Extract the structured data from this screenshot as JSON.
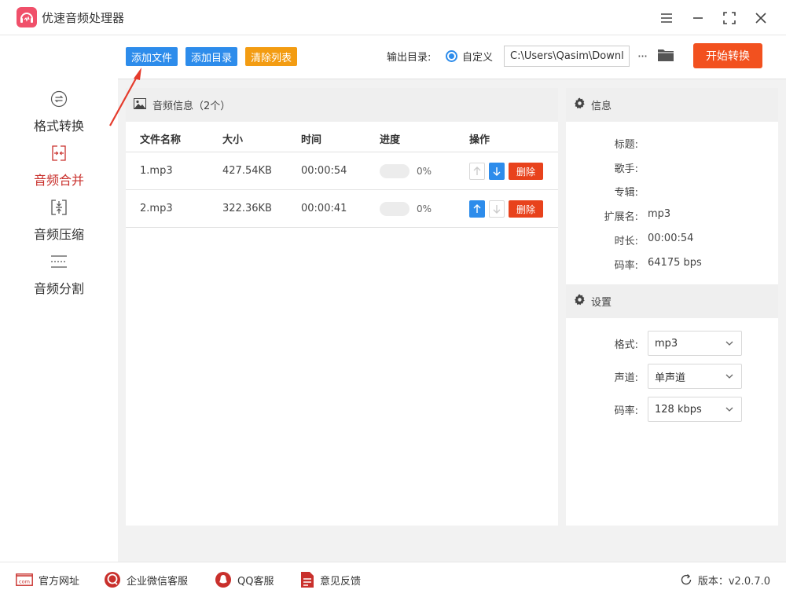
{
  "app": {
    "title": "优速音频处理器"
  },
  "sidebar": {
    "items": [
      {
        "label": "格式转换",
        "icon": "format-convert-icon",
        "active": false
      },
      {
        "label": "音频合并",
        "icon": "audio-merge-icon",
        "active": true
      },
      {
        "label": "音频压缩",
        "icon": "audio-compress-icon",
        "active": false
      },
      {
        "label": "音频分割",
        "icon": "audio-split-icon",
        "active": false
      }
    ]
  },
  "toolbar": {
    "add_file": "添加文件",
    "add_dir": "添加目录",
    "clear_list": "清除列表",
    "output_label": "输出目录:",
    "output_option": "自定义",
    "output_path": "C:\\Users\\Qasim\\Downloads",
    "more": "···",
    "start": "开始转换"
  },
  "audio_panel": {
    "title": "音频信息（2个）",
    "columns": [
      "文件名称",
      "大小",
      "时间",
      "进度",
      "操作"
    ],
    "rows": [
      {
        "name": "1.mp3",
        "size": "427.54KB",
        "time": "00:00:54",
        "progress": "0%",
        "delete": "删除",
        "up_enabled": false,
        "down_enabled": true
      },
      {
        "name": "2.mp3",
        "size": "322.36KB",
        "time": "00:00:41",
        "progress": "0%",
        "delete": "删除",
        "up_enabled": true,
        "down_enabled": false
      }
    ]
  },
  "info_panel": {
    "title": "信息",
    "fields": [
      {
        "key": "标题:",
        "value": ""
      },
      {
        "key": "歌手:",
        "value": ""
      },
      {
        "key": "专辑:",
        "value": ""
      },
      {
        "key": "扩展名:",
        "value": "mp3"
      },
      {
        "key": "时长:",
        "value": "00:00:54"
      },
      {
        "key": "码率:",
        "value": "64175 bps"
      }
    ]
  },
  "settings_panel": {
    "title": "设置",
    "fields": [
      {
        "key": "格式:",
        "value": "mp3"
      },
      {
        "key": "声道:",
        "value": "单声道"
      },
      {
        "key": "码率:",
        "value": "128 kbps"
      }
    ]
  },
  "footer": {
    "website": "官方网址",
    "wechat": "企业微信客服",
    "qq": "QQ客服",
    "feedback": "意见反馈",
    "version": "版本：v2.0.7.0",
    "com_text": "com"
  },
  "colors": {
    "accent_blue": "#2d8ceb",
    "accent_orange": "#f39c12",
    "start_red": "#f2511f",
    "delete_red": "#e8421c",
    "active_red": "#c9302c"
  }
}
